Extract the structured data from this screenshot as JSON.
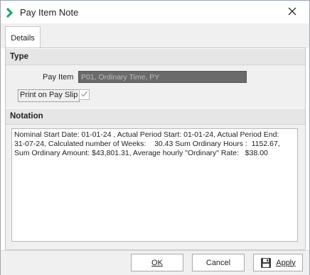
{
  "window": {
    "title": "Pay Item Note"
  },
  "tabs": [
    {
      "label": "Details"
    }
  ],
  "type_section": {
    "header": "Type",
    "pay_item_label": "Pay Item",
    "pay_item_value": "P01, Ordinary Time, PY",
    "print_label": "Print on Pay Slip",
    "print_checked": true
  },
  "notation_section": {
    "header": "Notation",
    "text": "Nominal Start Date: 01-01-24 , Actual Period Start: 01-01-24, Actual Period End:\n31-07-24, Calculated number of Weeks:    30.43 Sum Ordinary Hours :  1152.67,\nSum Ordinary Amount: $43,801.31, Average hourly \"Ordinary\" Rate:   $38.00"
  },
  "buttons": {
    "ok": "OK",
    "cancel": "Cancel",
    "apply": "Apply"
  },
  "icons": {
    "app": "chevron-app-icon",
    "close": "close-icon",
    "save": "floppy-disk-icon"
  },
  "colors": {
    "app_icon": "#1aa56a",
    "field_disabled_bg": "#6a6a6a"
  }
}
